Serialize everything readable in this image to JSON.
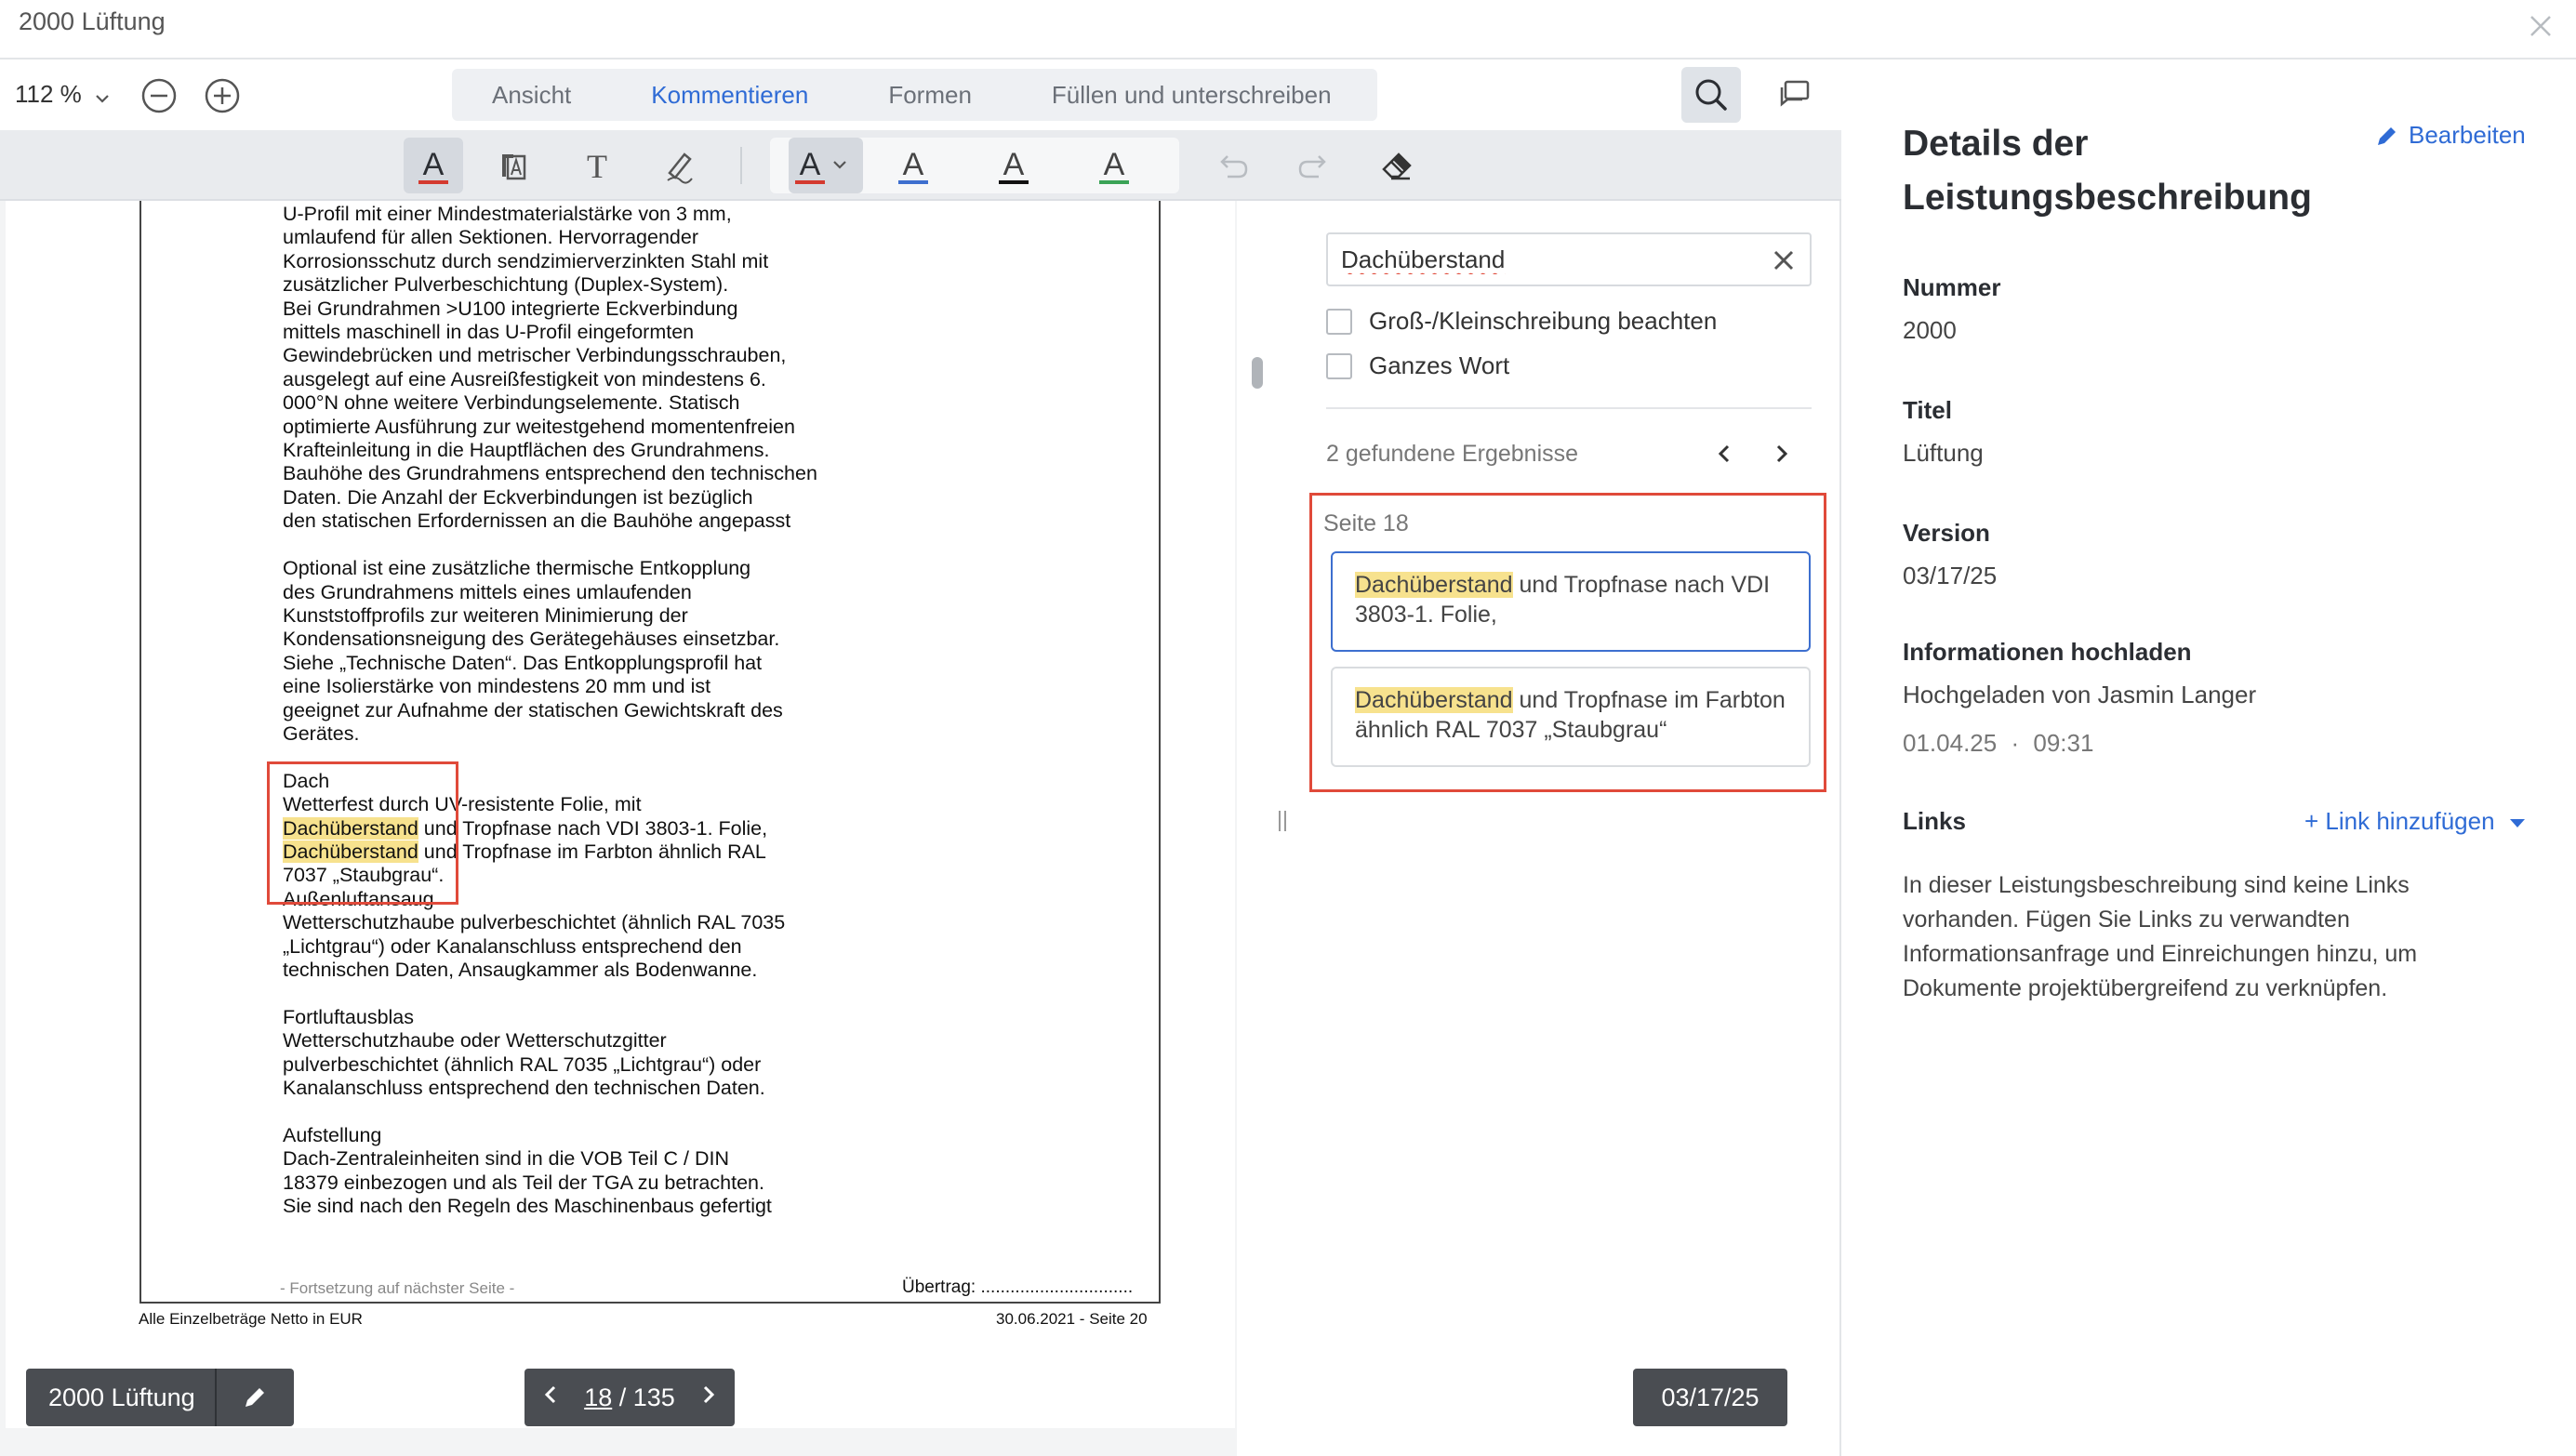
{
  "window": {
    "title": "2000 Lüftung"
  },
  "toolbar": {
    "zoom": "112 %",
    "tabs": [
      {
        "label": "Ansicht",
        "active": false
      },
      {
        "label": "Kommentieren",
        "active": true
      },
      {
        "label": "Formen",
        "active": false
      },
      {
        "label": "Füllen und unterschreiben",
        "active": false
      }
    ]
  },
  "annotation_tools": {
    "tool_glyph": "A",
    "text_tool_glyph": "T",
    "colors": {
      "text_red": "#d43a2f",
      "underline_blue": "#3d6fcf",
      "underline_black": "#111111",
      "underline_green": "#3aa356"
    }
  },
  "document": {
    "lines": [
      {
        "segments": [
          {
            "text": "U-Profil mit einer Mindestmaterialstärke von 3 mm,"
          }
        ]
      },
      {
        "segments": [
          {
            "text": "umlaufend für allen Sektionen. Hervorragender"
          }
        ]
      },
      {
        "segments": [
          {
            "text": "Korrosionsschutz durch sendzimierverzinkten Stahl mit"
          }
        ]
      },
      {
        "segments": [
          {
            "text": "zusätzlicher Pulverbeschichtung (Duplex-System)."
          }
        ]
      },
      {
        "segments": [
          {
            "text": "Bei Grundrahmen >U100 integrierte Eckverbindung"
          }
        ]
      },
      {
        "segments": [
          {
            "text": "mittels maschinell in das U-Profil eingeformten"
          }
        ]
      },
      {
        "segments": [
          {
            "text": "Gewindebrücken und metrischer Verbindungsschrauben,"
          }
        ]
      },
      {
        "segments": [
          {
            "text": "ausgelegt auf eine Ausreißfestigkeit von mindestens 6."
          }
        ]
      },
      {
        "segments": [
          {
            "text": "000°N ohne weitere Verbindungselemente. Statisch"
          }
        ]
      },
      {
        "segments": [
          {
            "text": "optimierte Ausführung zur weitestgehend momentenfreien"
          }
        ]
      },
      {
        "segments": [
          {
            "text": "Krafteinleitung in die Hauptflächen des Grundrahmens."
          }
        ]
      },
      {
        "segments": [
          {
            "text": "Bauhöhe des Grundrahmens entsprechend den technischen"
          }
        ]
      },
      {
        "segments": [
          {
            "text": "Daten. Die Anzahl der Eckverbindungen ist bezüglich"
          }
        ]
      },
      {
        "segments": [
          {
            "text": "den statischen Erfordernissen an die Bauhöhe angepasst"
          }
        ]
      },
      {
        "segments": [
          {
            "text": ""
          }
        ]
      },
      {
        "segments": [
          {
            "text": "Optional ist eine zusätzliche thermische Entkopplung"
          }
        ]
      },
      {
        "segments": [
          {
            "text": "des Grundrahmens mittels eines umlaufenden"
          }
        ]
      },
      {
        "segments": [
          {
            "text": "Kunststoffprofils zur weiteren Minimierung der"
          }
        ]
      },
      {
        "segments": [
          {
            "text": "Kondensationsneigung des Gerätegehäuses einsetzbar."
          }
        ]
      },
      {
        "segments": [
          {
            "text": "Siehe „Technische Daten“. Das Entkopplungsprofil hat"
          }
        ]
      },
      {
        "segments": [
          {
            "text": "eine Isolierstärke von mindestens 20 mm und ist"
          }
        ]
      },
      {
        "segments": [
          {
            "text": "geeignet zur Aufnahme der statischen Gewichtskraft des"
          }
        ]
      },
      {
        "segments": [
          {
            "text": "Gerätes."
          }
        ]
      },
      {
        "segments": [
          {
            "text": ""
          }
        ]
      },
      {
        "segments": [
          {
            "text": "Dach"
          }
        ]
      },
      {
        "segments": [
          {
            "text": "Wetterfest durch UV-resistente Folie, mit"
          }
        ]
      },
      {
        "segments": [
          {
            "text": "Dachüberstand",
            "hl": true
          },
          {
            "text": " und Tropfnase nach VDI 3803-1. Folie,"
          }
        ]
      },
      {
        "segments": [
          {
            "text": "Dachüberstand",
            "hl": true
          },
          {
            "text": " und Tropfnase im Farbton ähnlich RAL"
          }
        ]
      },
      {
        "segments": [
          {
            "text": "7037 „Staubgrau“."
          }
        ]
      },
      {
        "segments": [
          {
            "text": "Außenluftansaug"
          }
        ]
      },
      {
        "segments": [
          {
            "text": "Wetterschutzhaube pulverbeschichtet (ähnlich RAL 7035"
          }
        ]
      },
      {
        "segments": [
          {
            "text": "„Lichtgrau“) oder Kanalanschluss entsprechend den"
          }
        ]
      },
      {
        "segments": [
          {
            "text": "technischen Daten, Ansaugkammer als Bodenwanne."
          }
        ]
      },
      {
        "segments": [
          {
            "text": ""
          }
        ]
      },
      {
        "segments": [
          {
            "text": "Fortluftausblas"
          }
        ]
      },
      {
        "segments": [
          {
            "text": "Wetterschutzhaube oder Wetterschutzgitter"
          }
        ]
      },
      {
        "segments": [
          {
            "text": "pulverbeschichtet (ähnlich RAL 7035 „Lichtgrau“) oder"
          }
        ]
      },
      {
        "segments": [
          {
            "text": "Kanalanschluss entsprechend den technischen Daten."
          }
        ]
      },
      {
        "segments": [
          {
            "text": ""
          }
        ]
      },
      {
        "segments": [
          {
            "text": "Aufstellung"
          }
        ]
      },
      {
        "segments": [
          {
            "text": "Dach-Zentraleinheiten sind in die VOB Teil C / DIN"
          }
        ]
      },
      {
        "segments": [
          {
            "text": "18379 einbezogen und als Teil der TGA zu betrachten."
          }
        ]
      },
      {
        "segments": [
          {
            "text": "Sie sind nach den Regeln des Maschinenbaus gefertigt"
          }
        ]
      }
    ],
    "footer_continue": "- Fortsetzung auf nächster Seite -",
    "footer_carry": "Übertrag: ...............................",
    "bottom_left": "Alle Einzelbeträge Netto in EUR",
    "bottom_right": "30.06.2021 - Seite 20"
  },
  "doc_bar": {
    "name": "2000 Lüftung",
    "current_page": "18",
    "total_pages": "/ 135"
  },
  "search": {
    "query": "Dachüberstand",
    "options": [
      {
        "label": "Groß-/Kleinschreibung beachten",
        "checked": false
      },
      {
        "label": "Ganzes Wort",
        "checked": false
      }
    ],
    "results_count": "2 gefundene Ergebnisse",
    "group_label": "Seite 18",
    "results": [
      {
        "match": "Dachüberstand",
        "rest": " und Tropfnase nach VDI 3803-1. Folie,",
        "active": true
      },
      {
        "match": "Dachüberstand",
        "rest": " und Tropfnase im Farbton ähnlich RAL 7037 „Staubgrau“",
        "active": false
      }
    ],
    "date_badge": "03/17/25"
  },
  "details": {
    "title": "Details der Leistungsbeschreibung",
    "edit_label": "Bearbeiten",
    "fields": {
      "nummer_label": "Nummer",
      "nummer_value": "2000",
      "titel_label": "Titel",
      "titel_value": "Lüftung",
      "version_label": "Version",
      "version_value": "03/17/25",
      "upload_label": "Informationen hochladen",
      "upload_value": "Hochgeladen von Jasmin Langer",
      "upload_date": "01.04.25",
      "upload_dot": "·",
      "upload_time": "09:31"
    },
    "links_label": "Links",
    "add_link_label": "+ Link hinzufügen",
    "links_desc": "In dieser Leistungsbeschreibung sind keine Links vorhanden. Fügen Sie Links zu verwandten Informationsanfrage und Einreichungen hinzu, um Dokumente projektübergreifend zu verknüpfen."
  },
  "colors": {
    "accent": "#2f6bd5",
    "highlight": "#f7e28e",
    "callout_red": "#e04a3a"
  }
}
